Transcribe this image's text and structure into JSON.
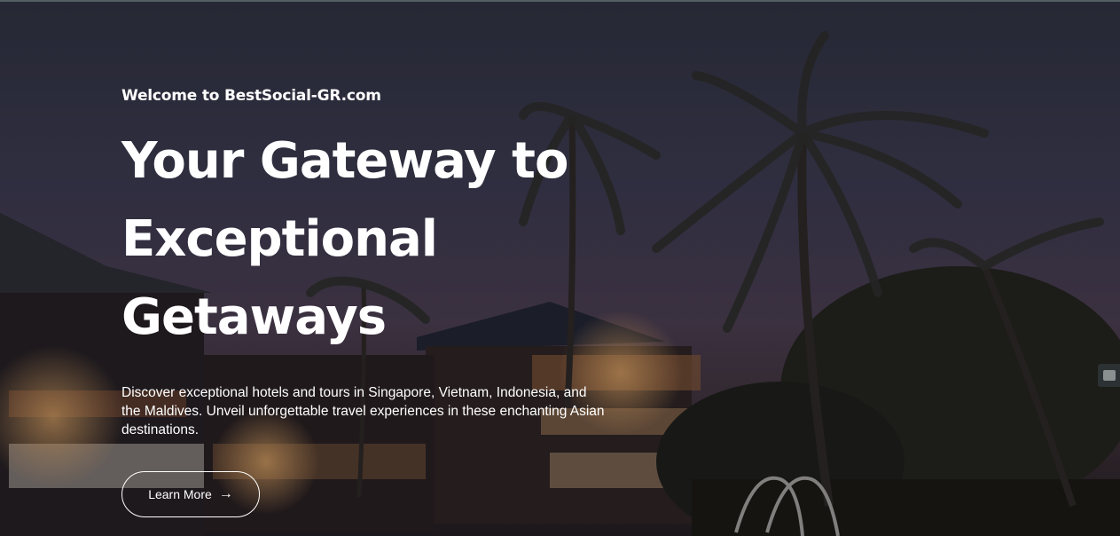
{
  "hero": {
    "eyebrow": "Welcome to BestSocial-GR.com",
    "headline_lines": [
      "Your Gateway to",
      "Exceptional",
      "Getaways"
    ],
    "description": "Discover exceptional hotels and tours in Singapore, Vietnam, Indonesia, and the Maldives. Unveil unforgettable travel experiences in these enchanting Asian destinations.",
    "cta_label": "Learn More",
    "cta_icon": "arrow-right-icon"
  },
  "side_widget": {
    "icon": "accessibility-widget-icon"
  },
  "colors": {
    "text": "#ffffff",
    "overlay": "#2b2d3c"
  }
}
